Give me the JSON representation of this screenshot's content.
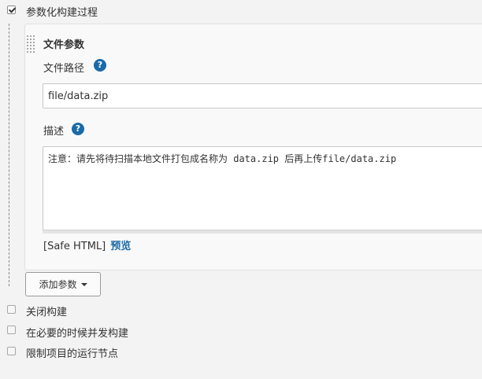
{
  "options": {
    "parameterized": {
      "label": "参数化构建过程",
      "checked": true
    },
    "disable_build": {
      "label": "关闭构建",
      "checked": false
    },
    "concurrent_build": {
      "label": "在必要的时候并发构建",
      "checked": false
    },
    "restrict_node": {
      "label": "限制项目的运行节点",
      "checked": false
    }
  },
  "file_param": {
    "title": "文件参数",
    "path_label": "文件路径",
    "path_value": "file/data.zip",
    "desc_label": "描述",
    "desc_value": "注意：请先将待扫描本地文件打包成名称为 data.zip 后再上传file/data.zip",
    "safe_html": "[Safe HTML]",
    "preview": "预览",
    "help_glyph": "?"
  },
  "add_param_button": "添加参数",
  "colors": {
    "link": "#1a6aa8",
    "help_icon": "#1a6aa8"
  }
}
